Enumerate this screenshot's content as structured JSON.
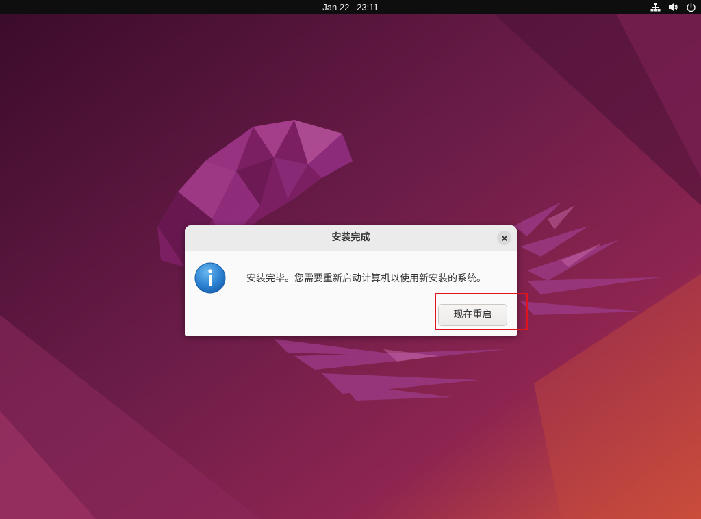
{
  "topbar": {
    "date": "Jan 22",
    "time": "23:11",
    "icons": [
      "network-icon",
      "volume-icon",
      "power-icon"
    ]
  },
  "dialog": {
    "title": "安装完成",
    "message": "安装完毕。您需要重新启动计算机以使用新安装的系统。",
    "restart_label": "现在重启",
    "icon": "info-icon",
    "close_icon": "close-icon"
  },
  "colors": {
    "topbar_bg": "#0e0e0e",
    "highlight": "#e0141e",
    "info_blue": "#2a7fd0"
  }
}
